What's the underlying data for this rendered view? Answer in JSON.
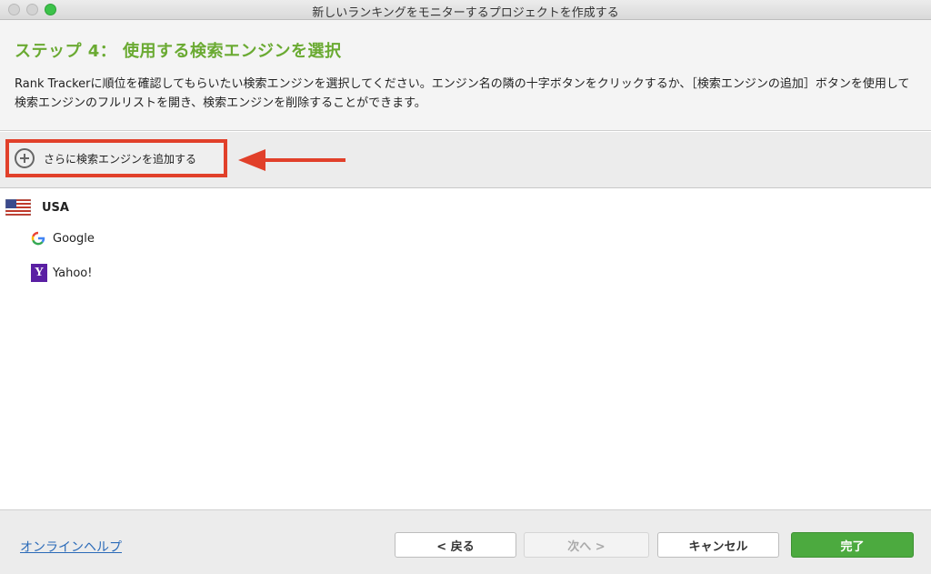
{
  "window": {
    "title": "新しいランキングをモニターするプロジェクトを作成する"
  },
  "header": {
    "step_title": "ステップ 4： 使用する検索エンジンを選択",
    "description": "Rank Trackerに順位を確認してもらいたい検索エンジンを選択してください。エンジン名の隣の十字ボタンをクリックするか、［検索エンジンの追加］ボタンを使用して検索エンジンのフルリストを開き、検索エンジンを削除することができます。"
  },
  "toolbar": {
    "add_label": "さらに検索エンジンを追加する",
    "highlight_color": "#e1402a"
  },
  "list": {
    "country": {
      "label": "USA",
      "flag_icon": "us-flag-icon"
    },
    "engines": [
      {
        "label": "Google",
        "icon": "google-icon"
      },
      {
        "label": "Yahoo!",
        "icon": "yahoo-icon"
      }
    ]
  },
  "footer": {
    "help_label": "オンラインヘルプ",
    "back_label": "< 戻る",
    "next_label": "次へ >",
    "cancel_label": "キャンセル",
    "finish_label": "完了"
  },
  "colors": {
    "accent_green": "#6aaa32",
    "finish_green": "#4caa3f",
    "link_blue": "#2a6ab8"
  }
}
